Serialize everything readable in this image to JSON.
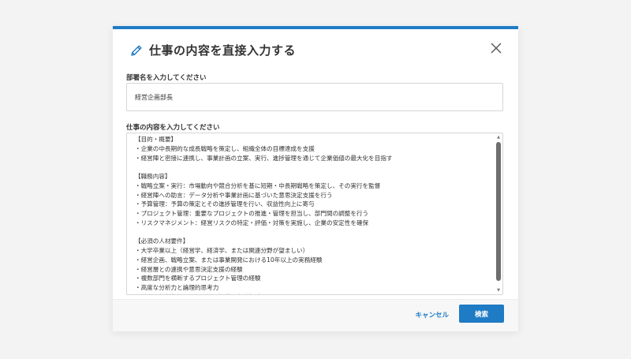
{
  "dialog": {
    "title": "仕事の内容を直接入力する",
    "accent_color": "#1f7bc4"
  },
  "department": {
    "label": "部署名を入力してください",
    "value": "経営企画部長"
  },
  "job_content": {
    "label": "仕事の内容を入力してください",
    "lines": [
      "【目的・概要】",
      "・企業の中長期的な成長戦略を策定し、組織全体の目標達成を支援",
      "・経営陣と密接に連携し、事業計画の立案、実行、進捗管理を通じて企業価値の最大化を目指す",
      "",
      "【職務内容】",
      "・戦略立案・実行：市場動向や競合分析を基に短期・中長期戦略を策定し、その実行を監督",
      "・経営陣への助言：データ分析や事業計画に基づいた意思決定支援を行う",
      "・予算管理：予算の策定とその進捗管理を行い、収益性向上に寄与",
      "・プロジェクト管理：重要なプロジェクトの推進・管理を担当し、部門間の調整を行う",
      "・リスクマネジメント：経営リスクの特定・評価・対策を実施し、企業の安定性を確保",
      "",
      "【必須の人材要件】",
      "・大学卒業以上（経営学、経済学、または関連分野が望ましい）",
      "・経営企画、戦略立案、または事業開発における10年以上の実務経験",
      "・経営層との連携や意思決定支援の経験",
      "・複数部門を横断するプロジェクト管理の経験",
      "・高度な分析力と論理的思考力",
      "・財務・経営指標に関する深い知識と実務経験"
    ]
  },
  "footer": {
    "cancel_label": "キャンセル",
    "search_label": "検索"
  }
}
